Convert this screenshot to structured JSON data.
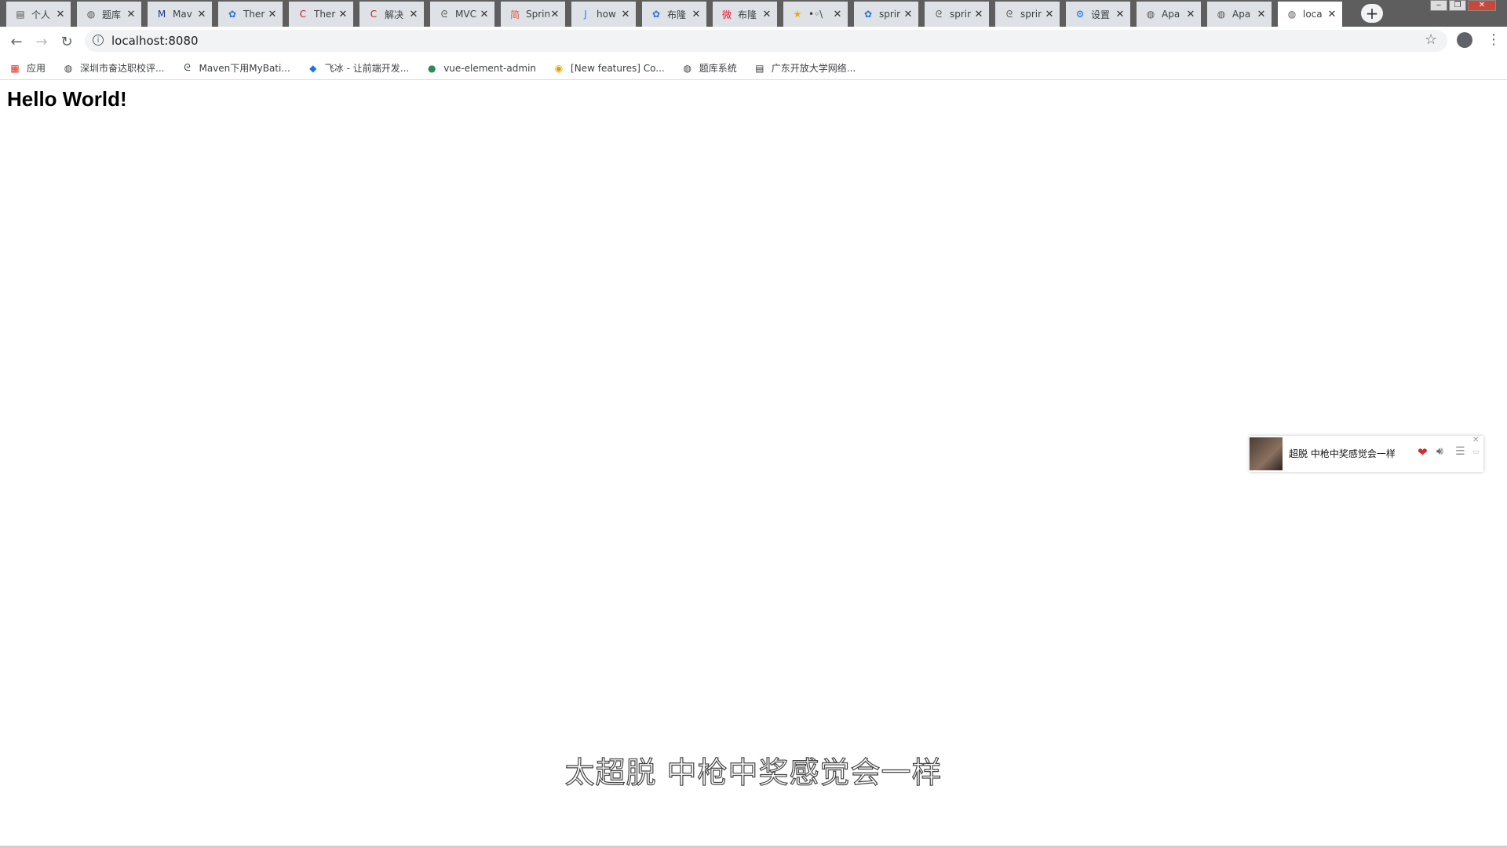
{
  "tabs": [
    {
      "title": "个人",
      "icon": "doc-icon"
    },
    {
      "title": "题库",
      "icon": "globe-icon"
    },
    {
      "title": "Mav",
      "icon": "mvn-icon"
    },
    {
      "title": "Ther",
      "icon": "baidu-paw-icon"
    },
    {
      "title": "Ther",
      "icon": "csdn-icon"
    },
    {
      "title": "解决",
      "icon": "csdn-icon"
    },
    {
      "title": "MVC",
      "icon": "wrench-icon"
    },
    {
      "title": "Sprin",
      "icon": "jianshu-icon"
    },
    {
      "title": "how",
      "icon": "juejin-icon"
    },
    {
      "title": "布隆",
      "icon": "baidu-paw-icon"
    },
    {
      "title": "布隆",
      "icon": "weibo-icon"
    },
    {
      "title": "•◦\\",
      "icon": "star-icon"
    },
    {
      "title": "sprir",
      "icon": "baidu-paw-icon"
    },
    {
      "title": "sprir",
      "icon": "wrench-icon"
    },
    {
      "title": "sprir",
      "icon": "wrench-icon"
    },
    {
      "title": "设置",
      "icon": "gear-icon"
    },
    {
      "title": "Apa",
      "icon": "globe-icon"
    },
    {
      "title": "Apa",
      "icon": "globe-icon"
    },
    {
      "title": "loca",
      "icon": "globe-icon",
      "active": true
    }
  ],
  "address": {
    "url": "localhost:8080"
  },
  "bookmarks": [
    {
      "label": "应用",
      "icon": "apps-grid-icon"
    },
    {
      "label": "深圳市奋达职校评...",
      "icon": "globe-icon"
    },
    {
      "label": "Maven下用MyBati...",
      "icon": "wrench-icon"
    },
    {
      "label": "飞冰 - 让前端开发...",
      "icon": "fish-icon"
    },
    {
      "label": "vue-element-admin",
      "icon": "vue-icon"
    },
    {
      "label": "[New features] Co...",
      "icon": "chrome-icon"
    },
    {
      "label": "题库系统",
      "icon": "globe-icon"
    },
    {
      "label": "广东开放大学网络...",
      "icon": "doc-icon"
    }
  ],
  "page": {
    "heading": "Hello World!"
  },
  "player": {
    "song": "超脱 中枪中奖感觉会一样",
    "heart_color": "#d52b2b"
  },
  "lyric": "太超脱 中枪中奖感觉会一样"
}
